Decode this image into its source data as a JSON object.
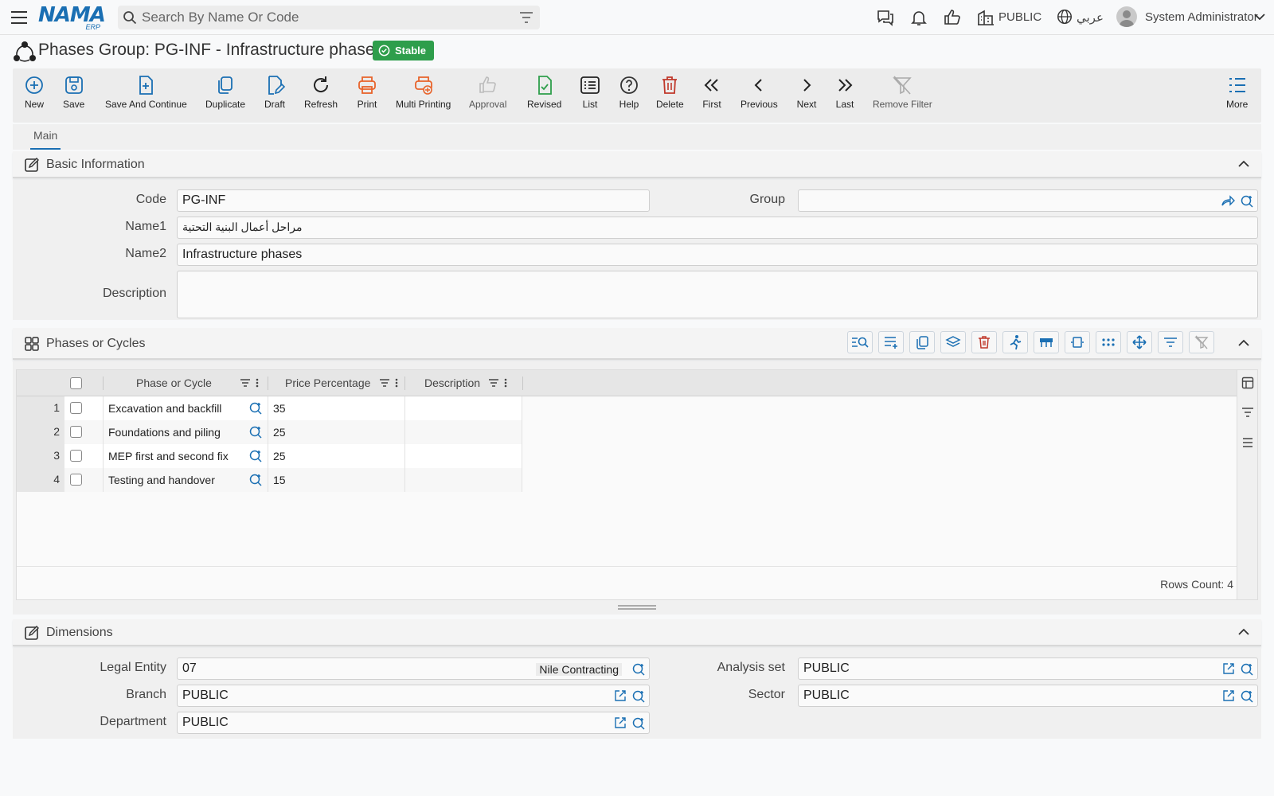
{
  "app": {
    "logo_text": "NAMA",
    "logo_sub": "ERP",
    "search_placeholder": "Search By Name Or Code",
    "branch_label": "PUBLIC",
    "language_label": "عربي",
    "user_name": "System Administrator"
  },
  "page": {
    "title": "Phases Group: PG-INF - Infrastructure phases",
    "status": "Stable",
    "status_color": "#2e9e4b"
  },
  "toolbar": {
    "new": "New",
    "save": "Save",
    "save_continue": "Save And Continue",
    "duplicate": "Duplicate",
    "draft": "Draft",
    "refresh": "Refresh",
    "print": "Print",
    "multi_printing": "Multi Printing",
    "approval": "Approval",
    "revised": "Revised",
    "list": "List",
    "help": "Help",
    "delete": "Delete",
    "first": "First",
    "previous": "Previous",
    "next": "Next",
    "last": "Last",
    "remove_filter": "Remove Filter",
    "more": "More"
  },
  "tabs": {
    "main": "Main"
  },
  "basic": {
    "title": "Basic Information",
    "code_label": "Code",
    "code_value": "PG-INF",
    "group_label": "Group",
    "group_value": "",
    "name1_label": "Name1",
    "name1_value": "مراحل أعمال البنية التحتية",
    "name2_label": "Name2",
    "name2_value": "Infrastructure phases",
    "description_label": "Description",
    "description_value": ""
  },
  "phases": {
    "title": "Phases or Cycles",
    "columns": {
      "phase": "Phase or Cycle",
      "price": "Price Percentage",
      "description": "Description"
    },
    "rows": [
      {
        "num": "1",
        "phase": "Excavation and backfill",
        "price": "35",
        "description": ""
      },
      {
        "num": "2",
        "phase": "Foundations and piling",
        "price": "25",
        "description": ""
      },
      {
        "num": "3",
        "phase": "MEP first and second fix",
        "price": "25",
        "description": ""
      },
      {
        "num": "4",
        "phase": "Testing and handover",
        "price": "15",
        "description": ""
      }
    ],
    "rows_count": "Rows Count: 4"
  },
  "dimensions": {
    "title": "Dimensions",
    "legal_entity_label": "Legal Entity",
    "legal_entity_value": "07",
    "legal_entity_name": "Nile Contracting",
    "analysis_set_label": "Analysis set",
    "analysis_set_value": "PUBLIC",
    "branch_label": "Branch",
    "branch_value": "PUBLIC",
    "sector_label": "Sector",
    "sector_value": "PUBLIC",
    "department_label": "Department",
    "department_value": "PUBLIC"
  },
  "colors": {
    "primary": "#1a6fb3",
    "orange": "#e8632a",
    "green": "#2e9e4b",
    "red": "#c0392b"
  }
}
